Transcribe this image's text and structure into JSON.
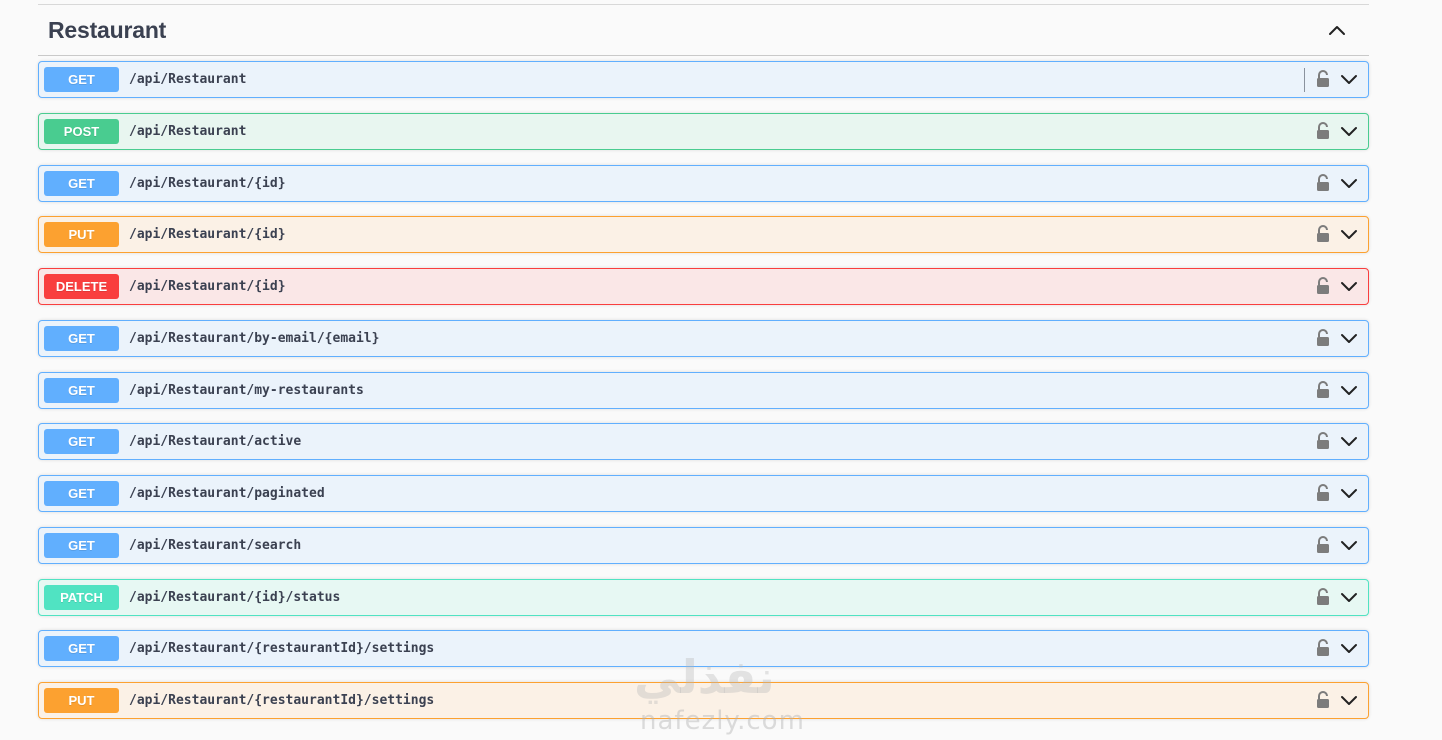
{
  "section": {
    "title": "Restaurant"
  },
  "operations": [
    {
      "method": "GET",
      "path": "/api/Restaurant"
    },
    {
      "method": "POST",
      "path": "/api/Restaurant"
    },
    {
      "method": "GET",
      "path": "/api/Restaurant/{id}"
    },
    {
      "method": "PUT",
      "path": "/api/Restaurant/{id}"
    },
    {
      "method": "DELETE",
      "path": "/api/Restaurant/{id}"
    },
    {
      "method": "GET",
      "path": "/api/Restaurant/by-email/{email}"
    },
    {
      "method": "GET",
      "path": "/api/Restaurant/my-restaurants"
    },
    {
      "method": "GET",
      "path": "/api/Restaurant/active"
    },
    {
      "method": "GET",
      "path": "/api/Restaurant/paginated"
    },
    {
      "method": "GET",
      "path": "/api/Restaurant/search"
    },
    {
      "method": "PATCH",
      "path": "/api/Restaurant/{id}/status"
    },
    {
      "method": "GET",
      "path": "/api/Restaurant/{restaurantId}/settings"
    },
    {
      "method": "PUT",
      "path": "/api/Restaurant/{restaurantId}/settings"
    }
  ],
  "icons": {
    "collapse": "chevron-up-icon",
    "lock": "lock-icon",
    "expand": "chevron-down-icon"
  },
  "colors": {
    "get": "#61affe",
    "post": "#49cc90",
    "put": "#fca130",
    "delete": "#f93e3e",
    "patch": "#50e3c2",
    "text": "#3b4151"
  },
  "watermark": {
    "arabic": "نفذلي",
    "latin": "nafezly.com"
  }
}
